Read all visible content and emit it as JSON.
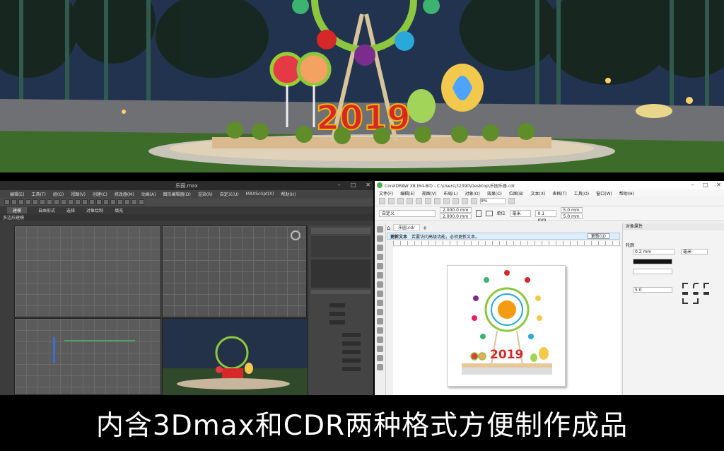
{
  "caption": "内含3Dmax和CDR两种格式方便制作成品",
  "scene": {
    "year_text": "2019"
  },
  "max_window": {
    "title": "乐园.max",
    "menu": [
      "编辑(E)",
      "工具(T)",
      "组(G)",
      "视图(V)",
      "创建(C)",
      "修改器(M)",
      "动画(A)",
      "图形编辑器(D)",
      "渲染(R)",
      "自定义(U)",
      "MAXScript(X)",
      "帮助(H)"
    ],
    "ribbon_tabs": [
      "建模",
      "自由形式",
      "选择",
      "对象绘制",
      "填充"
    ],
    "ribbon_sub": "多边形建模"
  },
  "cdr_window": {
    "title": "CorelDRAW X8 (64-Bit) - C:\\Users\\32390\\Desktop\\乐园乐器.cdr",
    "menu": [
      "文件(F)",
      "编辑(E)",
      "视图(V)",
      "布局(L)",
      "对象(O)",
      "效果(C)",
      "位图(B)",
      "文本(X)",
      "表格(T)",
      "工具(O)",
      "窗口(W)",
      "帮助(H)"
    ],
    "preset_select": "自定义",
    "zoom_value": "9%",
    "width_value": "2,000.0 mm",
    "height_value": "2,000.0 mm",
    "units_label": "单位",
    "units_value": "毫米",
    "nudge_value": "0.1 mm",
    "dup_x": "5.0 mm",
    "dup_y": "5.0 mm",
    "doc_tab": "乐园.cdr",
    "notice_title": "更新文本",
    "notice_text": "若要访问高级功能，必须更新文本。",
    "notice_button": "更新(U)",
    "panel_title": "对象属性",
    "outline_label": "轮廓",
    "outline_width": "0.2 mm",
    "outline_units": "毫米",
    "miter_value": "5.0",
    "page_year": "2019"
  }
}
